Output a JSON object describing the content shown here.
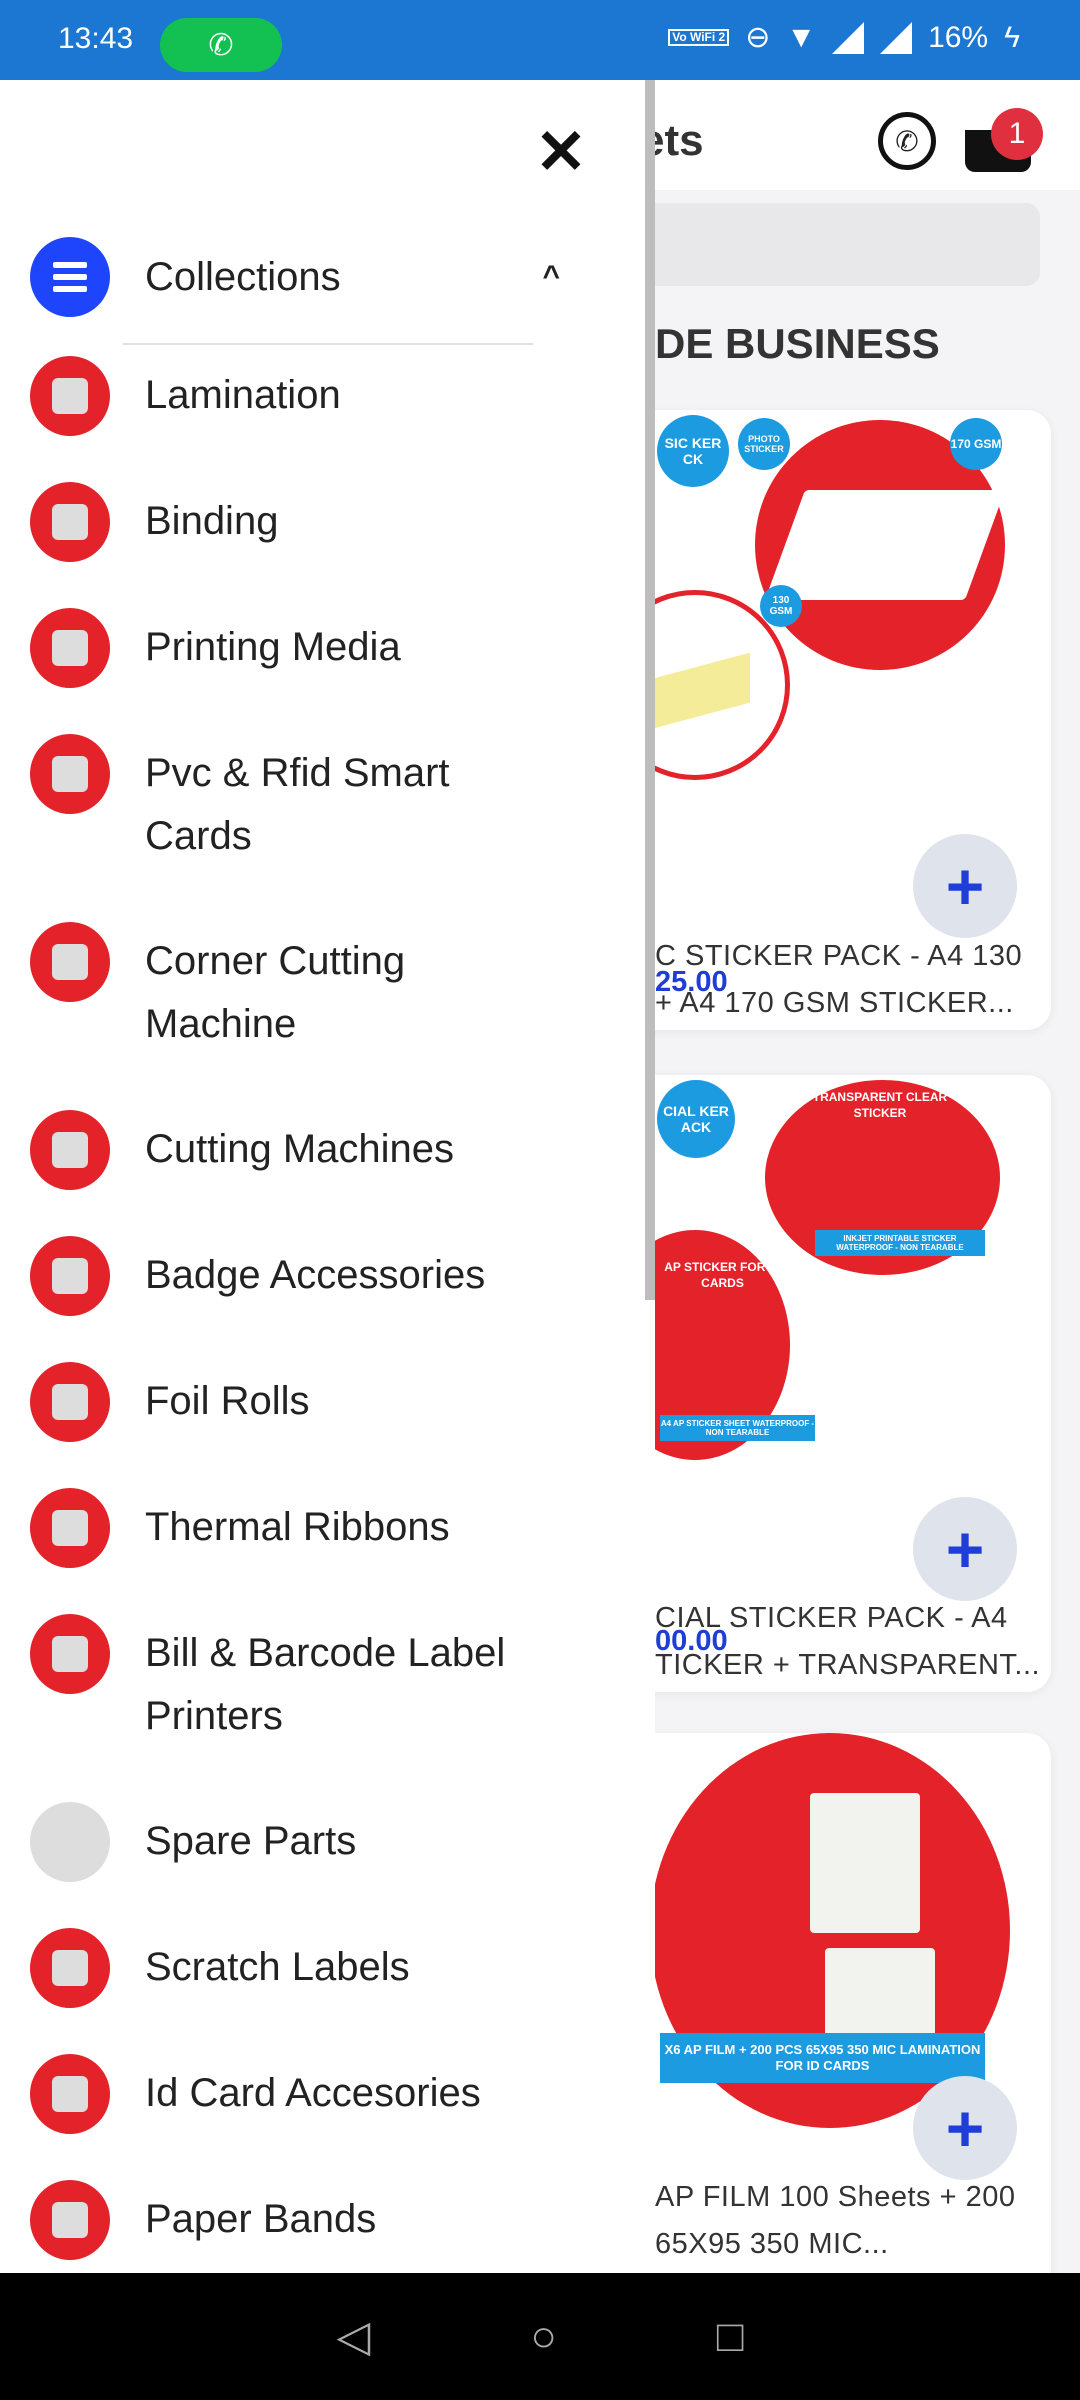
{
  "status_bar": {
    "time": "13:43",
    "network": "Vo WiFi 2",
    "battery": "16%"
  },
  "background_page": {
    "title_fragment": "ets",
    "cart_count": "1",
    "section_title_fragment": "DE BUSINESS",
    "products": [
      {
        "name_line1": "C STICKER PACK - A4 130",
        "name_line2": "+ A4 170 GSM STICKER...",
        "price": "25.00",
        "image_text": [
          "SIC KER CK",
          "PHOTO STICKER",
          "170 GSM",
          "130 GSM"
        ]
      },
      {
        "name_line1": "CIAL STICKER PACK - A4",
        "name_line2": "TICKER + TRANSPARENT...",
        "price": "00.00",
        "image_text": [
          "CIAL KER ACK",
          "TRANSPARENT CLEAR STICKER",
          "AP STICKER FOR ID CARDS",
          "INKJET PRINTABLE STICKER WATERPROOF - NON TEARABLE",
          "A4 AP STICKER SHEET WATERPROOF - NON TEARABLE"
        ]
      },
      {
        "name_line1": "AP FILM 100 Sheets + 200",
        "name_line2": "65X95 350 MIC...",
        "image_text": [
          "X6 AP FILM + 200 PCS 65X95 350 MIC LAMINATION FOR ID CARDS"
        ]
      }
    ]
  },
  "drawer": {
    "close_icon": "close-icon",
    "collections_label": "Collections",
    "items": [
      {
        "label": "Lamination"
      },
      {
        "label": "Binding"
      },
      {
        "label": "Printing Media"
      },
      {
        "label": "Pvc & Rfid Smart Cards"
      },
      {
        "label": "Corner Cutting Machine"
      },
      {
        "label": "Cutting Machines"
      },
      {
        "label": "Badge Accessories"
      },
      {
        "label": "Foil Rolls"
      },
      {
        "label": "Thermal Ribbons"
      },
      {
        "label": "Bill & Barcode Label Printers"
      },
      {
        "label": "Spare Parts"
      },
      {
        "label": "Scratch Labels"
      },
      {
        "label": "Id Card Accesories"
      },
      {
        "label": "Paper Bands"
      }
    ]
  },
  "colors": {
    "status_bar": "#1b77d2",
    "accent": "#1f45fc",
    "brand_red": "#e3222a",
    "price": "#1f3ed8"
  }
}
